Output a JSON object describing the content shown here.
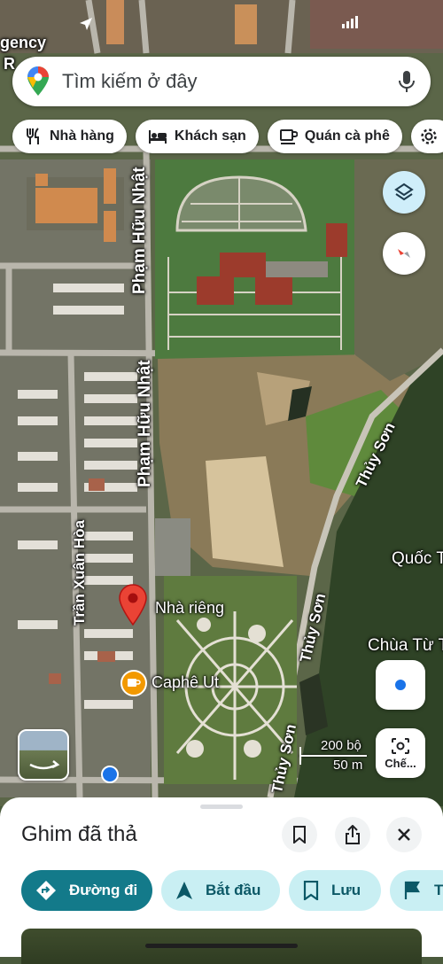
{
  "search": {
    "placeholder": "Tìm kiếm ở đây"
  },
  "chips": [
    {
      "label": "Nhà hàng",
      "icon": "restaurant-icon"
    },
    {
      "label": "Khách sạn",
      "icon": "hotel-icon"
    },
    {
      "label": "Quán cà phê",
      "icon": "coffee-icon"
    }
  ],
  "map": {
    "labels": {
      "agency_top": "gency",
      "agency_r": "R",
      "pham_huu_nhat_1": "Phạm Hữu Nhật",
      "pham_huu_nhat_2": "Phạm Hữu Nhật",
      "tran_xuan_hoa": "Trần Xuân Hòa",
      "thuy_son_1": "Thủy Sơn",
      "thuy_son_2": "Thủy Sơn",
      "thuy_son_3": "Thủy Sơn",
      "quoc_t": "Quốc T",
      "chua_tu_t": "Chùa Từ T",
      "pin_label": "Nhà riêng",
      "cafe_label": "Caphê Ut"
    },
    "scale": {
      "top": "200 bộ",
      "bottom": "50 m"
    },
    "lens_label": "Chế..."
  },
  "sheet": {
    "title": "Ghim đã thả",
    "actions": [
      {
        "label": "Đường đi",
        "icon": "directions-icon"
      },
      {
        "label": "Bắt đầu",
        "icon": "navigation-arrow-icon"
      },
      {
        "label": "Lưu",
        "icon": "bookmark-icon"
      },
      {
        "label": "T",
        "icon": "flag-icon"
      }
    ]
  },
  "colors": {
    "accent": "#137a8a",
    "accent_light": "#c9eff3",
    "pin_red": "#ea4335"
  }
}
